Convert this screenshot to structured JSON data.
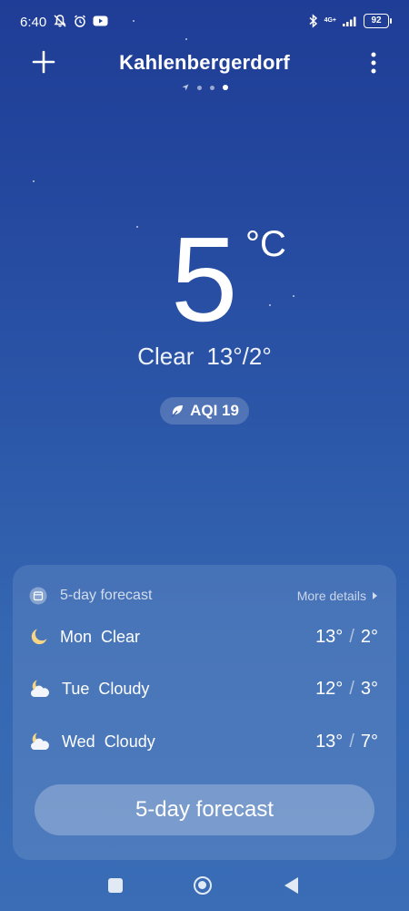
{
  "status_bar": {
    "time": "6:40",
    "network": "4G+",
    "battery": "92"
  },
  "header": {
    "city": "Kahlenbergerdorf"
  },
  "current": {
    "temperature": "5",
    "unit": "°C",
    "condition": "Clear",
    "high_low": "13°/2°",
    "aqi": "AQI 19"
  },
  "forecast_card": {
    "title": "5-day forecast",
    "more_details": "More details",
    "days": [
      {
        "day": "Mon",
        "condition": "Clear",
        "icon": "moon-icon",
        "high": "13°",
        "low": "2°"
      },
      {
        "day": "Tue",
        "condition": "Cloudy",
        "icon": "cloud-moon-icon",
        "high": "12°",
        "low": "3°"
      },
      {
        "day": "Wed",
        "condition": "Cloudy",
        "icon": "cloud-moon-icon",
        "high": "13°",
        "low": "7°"
      }
    ],
    "button_label": "5-day forecast"
  }
}
